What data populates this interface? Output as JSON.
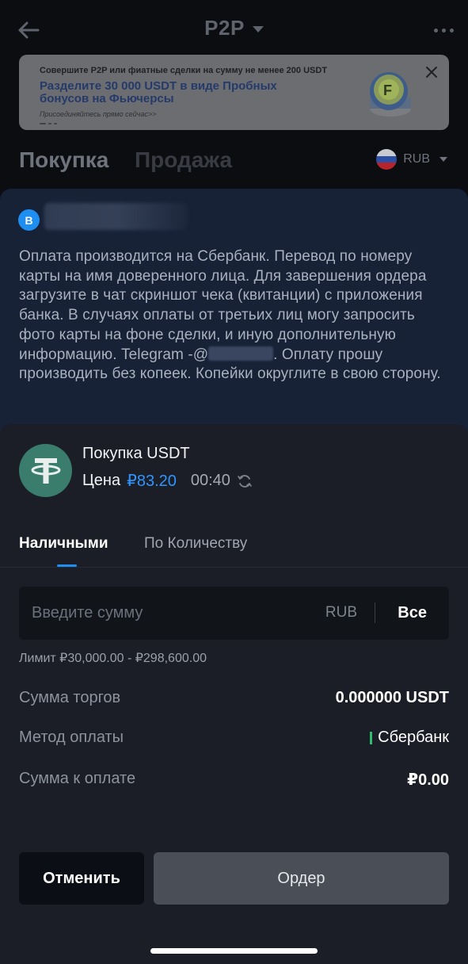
{
  "header": {
    "title": "P2P",
    "back_icon": "arrow-left-icon",
    "more_icon": "more-horizontal-icon"
  },
  "banner": {
    "line1": "Совершите P2P или фиатные сделки на сумму не менее 200 USDT",
    "line2": "Разделите 30 000 USDT в виде Пробных бонусов на Фьючерсы",
    "line3": "Присоединяйтесь прямо сейчас>>"
  },
  "tabs": {
    "buy": "Покупка",
    "sell": "Продажа",
    "currency": "RUB"
  },
  "seller": {
    "initial": "В"
  },
  "terms": {
    "part1": "Оплата производится на Сбербанк.  Перевод по номеру карты на имя доверенного лица. Для завершения ордера  загрузите в чат скриншот чека (квитанции) с приложения банка.  В  случаях оплаты от третьих лиц  могу запросить фото карты на фоне сделки, и иную дополнительную информацию. Telegram -@",
    "part2": ". Оплату прошу производить без копеек. Копейки округлите  в свою сторону."
  },
  "order": {
    "title": "Покупка USDT",
    "price_label": "Цена",
    "price_value": "₽83.20",
    "timer": "00:40"
  },
  "mode_tabs": {
    "cash": "Наличными",
    "quantity": "По Количеству"
  },
  "amount_input": {
    "placeholder": "Введите сумму",
    "unit": "RUB",
    "all_label": "Все"
  },
  "limit_text": "Лимит ₽30,000.00 - ₽298,600.00",
  "details": {
    "trade_amount_label": "Сумма торгов",
    "trade_amount_value": "0.000000 USDT",
    "payment_method_label": "Метод оплаты",
    "payment_method_value": "Сбербанк",
    "payable_label": "Сумма к оплате",
    "payable_value": "₽0.00"
  },
  "actions": {
    "cancel": "Отменить",
    "order": "Ордер"
  },
  "colors": {
    "accent": "#1f8ef1",
    "price": "#2f95ff",
    "payment_bar": "#2ebd6e",
    "tether": "#3a7d6c"
  }
}
